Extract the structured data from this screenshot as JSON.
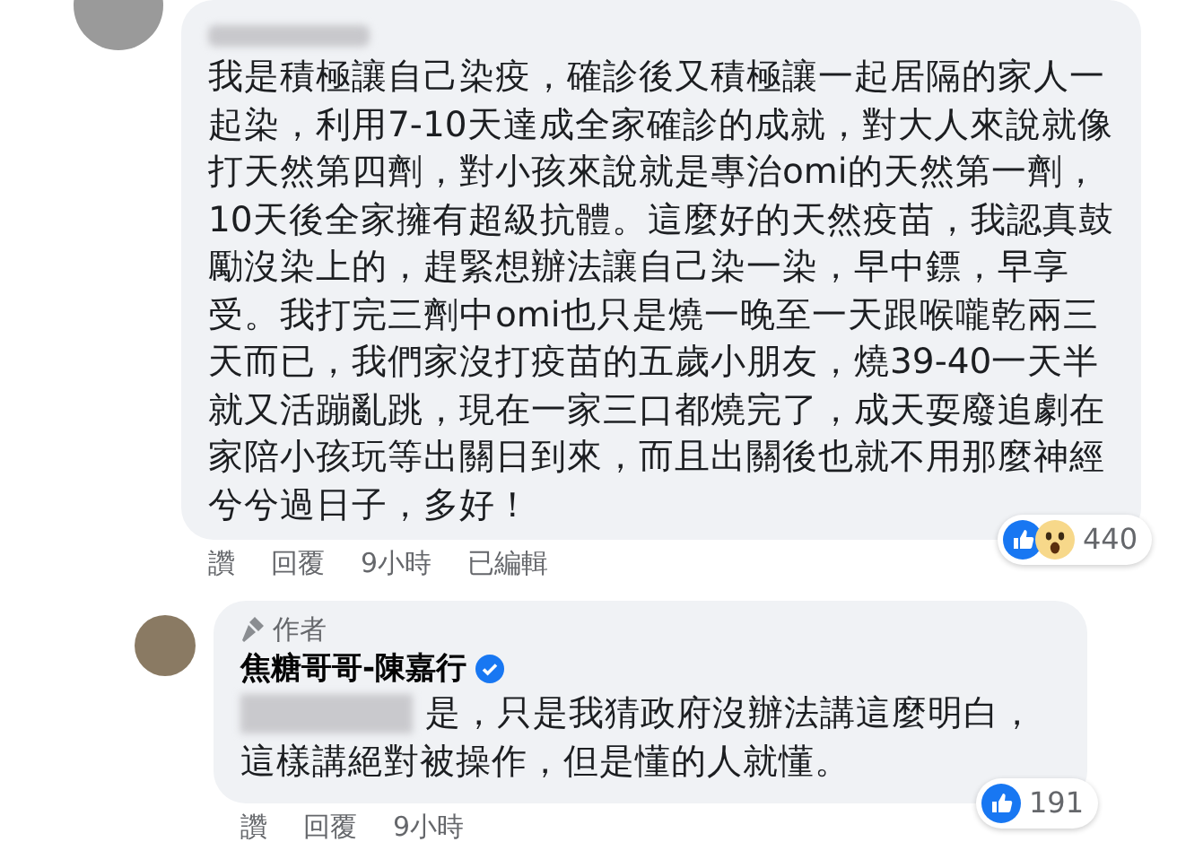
{
  "comments": [
    {
      "name_redacted": true,
      "lines": [
        "我是積極讓自己染疫，確診後又積極讓一起居隔的家人一",
        "起染，利用7-10天達成全家確診的成就，對大人來說就像",
        "打天然第四劑，對小孩來說就是專治omi的天然第一劑，",
        "10天後全家擁有超級抗體。這麼好的天然疫苗，我認真鼓",
        "勵沒染上的，趕緊想辦法讓自己染一染，早中鏢，早享",
        "受。我打完三劑中omi也只是燒一晚至一天跟喉嚨乾兩三",
        "天而已，我們家沒打疫苗的五歲小朋友，燒39-40一天半",
        "就又活蹦亂跳，現在一家三口都燒完了，成天耍廢追劇在",
        "家陪小孩玩等出關日到來，而且出關後也就不用那麼神經",
        "兮兮過日子，多好！"
      ],
      "mention_redacted": false,
      "reactions": {
        "icons": [
          {
            "kind": "like"
          },
          {
            "kind": "wow"
          }
        ],
        "count": "440"
      },
      "actions": [
        "讚",
        "回覆",
        "9小時",
        "已編輯"
      ],
      "reply": false
    },
    {
      "author_badge": "作者",
      "author_name": "焦糖哥哥-陳嘉行",
      "verified": true,
      "name_redacted": false,
      "lines": [
        "是，只是我猜政府沒辦法講這麼明白，",
        "這樣講絕對被操作，但是懂的人就懂。"
      ],
      "mention_redacted": true,
      "reactions": {
        "icons": [
          {
            "kind": "like"
          }
        ],
        "count": "191"
      },
      "actions": [
        "讚",
        "回覆",
        "9小時"
      ],
      "reply": true
    }
  ]
}
